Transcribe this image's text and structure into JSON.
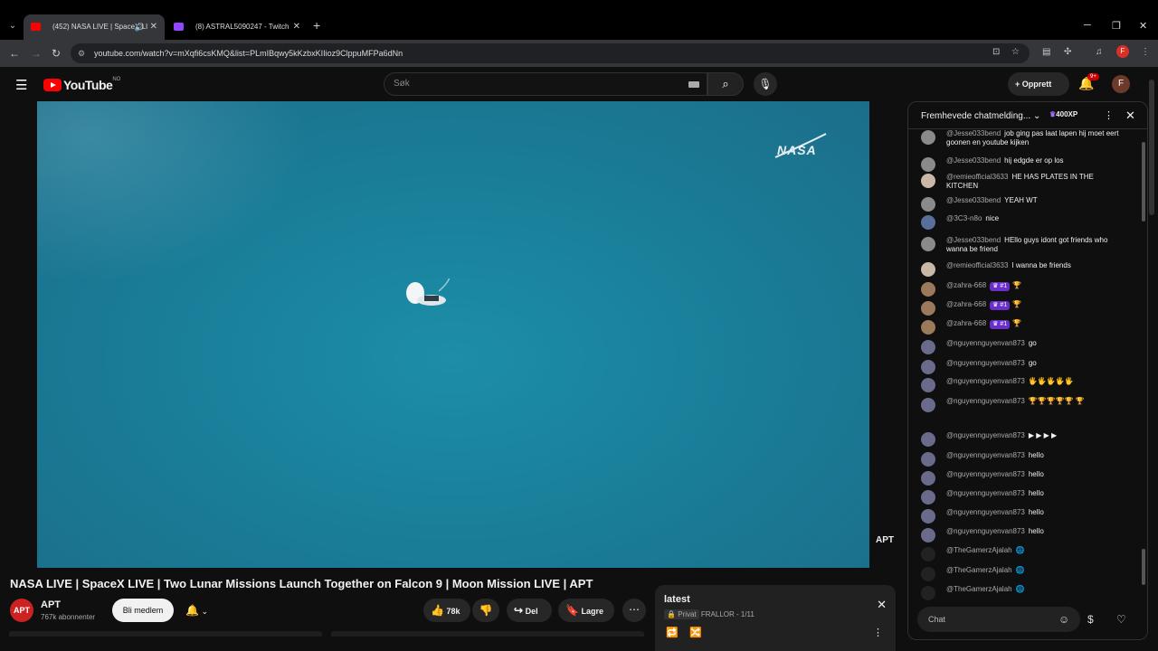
{
  "browser": {
    "tabs": [
      {
        "label": "(452) NASA LIVE | SpaceX LI",
        "favicon_color": "#ff0000",
        "active": true
      },
      {
        "label": "(8) ASTRAL5090247 - Twitch",
        "favicon_color": "#9146ff",
        "active": false
      }
    ],
    "url": "youtube.com/watch?v=mXqfi6csKMQ&list=PLmIBqwy5kKzbxKIIioz9ClppuMFPa6dNn",
    "profile_initial": "F"
  },
  "youtube": {
    "logo_text": "YouTube",
    "country_code": "NO",
    "search_placeholder": "Søk",
    "create_label": "Opprett",
    "notifications_badge": "9+",
    "avatar_initial": "F"
  },
  "video": {
    "watermark": "NASA",
    "channel_watermark": "APT",
    "title": "NASA LIVE | SpaceX LIVE | Two Lunar Missions Launch Together on Falcon 9 | Moon Mission LIVE | APT"
  },
  "channel": {
    "avatar_text": "APT",
    "name": "APT",
    "subscribers": "767k abonnenter",
    "join_label": "Bli medlem"
  },
  "actions": {
    "likes": "78k",
    "share_label": "Del",
    "save_label": "Lagre"
  },
  "playlist": {
    "title": "latest",
    "privacy": "Privat",
    "owner_position": "FRALLOR - 1/11"
  },
  "chat": {
    "header": "Fremhevede chatmelding...",
    "xp": "400XP",
    "input_placeholder": "Chat",
    "messages": [
      {
        "author": "@Jesse033bend",
        "text": "job ging pas laat lapen hij moet eert goonen en youtube kijken",
        "badge": "",
        "avatar": "#8a8a8a"
      },
      {
        "author": "@Jesse033bend",
        "text": "hij edgde er op los",
        "badge": "",
        "avatar": "#8a8a8a"
      },
      {
        "author": "@remieofficial3633",
        "text": "HE HAS PLATES IN THE KITCHEN",
        "badge": "",
        "avatar": "#c9b8a8"
      },
      {
        "author": "@Jesse033bend",
        "text": "YEAH WT",
        "badge": "",
        "avatar": "#8a8a8a"
      },
      {
        "author": "@ЗСЗ-n8o",
        "text": "nice",
        "badge": "",
        "avatar": "#5a6e9a"
      },
      {
        "author": "@Jesse033bend",
        "text": "HEllo guys idont got friends who wanna be friend",
        "badge": "",
        "avatar": "#8a8a8a"
      },
      {
        "author": "@remieofficial3633",
        "text": "I wanna be friends",
        "badge": "",
        "avatar": "#c9b8a8"
      },
      {
        "author": "@zahra-668",
        "text": "🏆",
        "badge": "♛ #1",
        "avatar": "#9a7a5a"
      },
      {
        "author": "@zahra-668",
        "text": "🏆",
        "badge": "♛ #1",
        "avatar": "#9a7a5a"
      },
      {
        "author": "@zahra-668",
        "text": "🏆",
        "badge": "♛ #1",
        "avatar": "#9a7a5a"
      },
      {
        "author": "@nguyennguyenvan873",
        "text": "go",
        "badge": "",
        "avatar": "#6a6a8a"
      },
      {
        "author": "@nguyennguyenvan873",
        "text": "go",
        "badge": "",
        "avatar": "#6a6a8a"
      },
      {
        "author": "@nguyennguyenvan873",
        "text": "🖐🖐🖐🖐🖐",
        "badge": "",
        "avatar": "#6a6a8a"
      },
      {
        "author": "@nguyennguyenvan873",
        "text": "🏆🏆🏆🏆🏆 🏆",
        "badge": "",
        "avatar": "#6a6a8a"
      },
      {
        "author": "@nguyennguyenvan873",
        "text": "▶ ▶ ▶ ▶",
        "badge": "",
        "avatar": "#6a6a8a"
      },
      {
        "author": "@nguyennguyenvan873",
        "text": "hello",
        "badge": "",
        "avatar": "#6a6a8a"
      },
      {
        "author": "@nguyennguyenvan873",
        "text": "hello",
        "badge": "",
        "avatar": "#6a6a8a"
      },
      {
        "author": "@nguyennguyenvan873",
        "text": "hello",
        "badge": "",
        "avatar": "#6a6a8a"
      },
      {
        "author": "@nguyennguyenvan873",
        "text": "hello",
        "badge": "",
        "avatar": "#6a6a8a"
      },
      {
        "author": "@nguyennguyenvan873",
        "text": "hello",
        "badge": "",
        "avatar": "#6a6a8a"
      },
      {
        "author": "@TheGamerzAjalah",
        "text": "🌐",
        "badge": "",
        "avatar": "#222"
      },
      {
        "author": "@TheGamerzAjalah",
        "text": "🌐",
        "badge": "",
        "avatar": "#222"
      },
      {
        "author": "@TheGamerzAjalah",
        "text": "🌐",
        "badge": "",
        "avatar": "#222"
      }
    ]
  },
  "colors": {
    "accent": "#ff0000",
    "ocean": "#1a7f9a",
    "badge_purple": "#6a2fc9"
  }
}
